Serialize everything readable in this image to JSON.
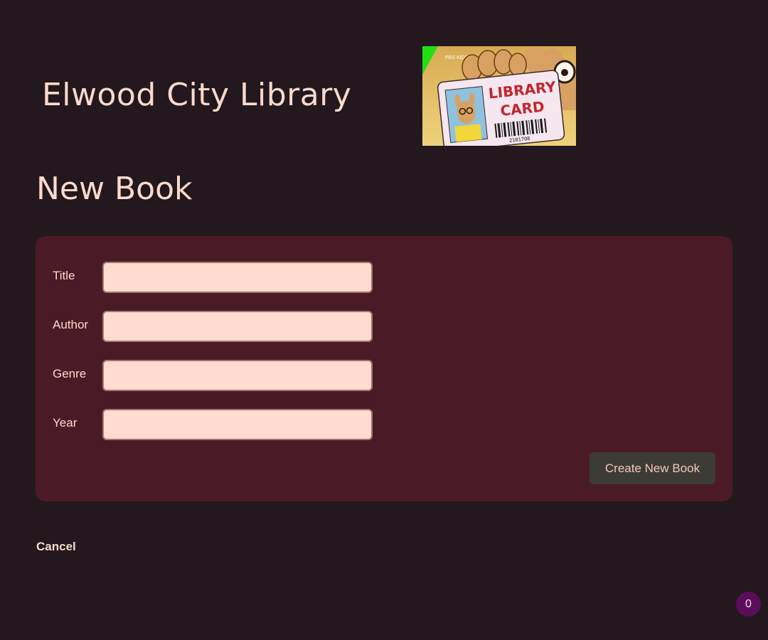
{
  "header": {
    "site_title": "Elwood City Library",
    "hero_image": {
      "icon": "library-card-image",
      "card_line1": "LIBRARY",
      "card_line2": "CARD",
      "barcode_number": "2101708",
      "channel_logo": "PBS KIDS"
    }
  },
  "page": {
    "title": "New Book"
  },
  "form": {
    "fields": [
      {
        "label": "Title",
        "value": "",
        "placeholder": ""
      },
      {
        "label": "Author",
        "value": "",
        "placeholder": ""
      },
      {
        "label": "Genre",
        "value": "",
        "placeholder": ""
      },
      {
        "label": "Year",
        "value": "",
        "placeholder": ""
      }
    ],
    "submit_label": "Create New Book"
  },
  "footer": {
    "cancel_label": "Cancel"
  },
  "badge": {
    "count": "0"
  },
  "colors": {
    "background": "#22181d",
    "card": "#4a1b26",
    "text": "#fbd9cc",
    "input_bg": "#ffdccd",
    "input_border": "#a77370",
    "button_bg": "#3c3b37",
    "badge_bg": "#5b0d5a"
  }
}
